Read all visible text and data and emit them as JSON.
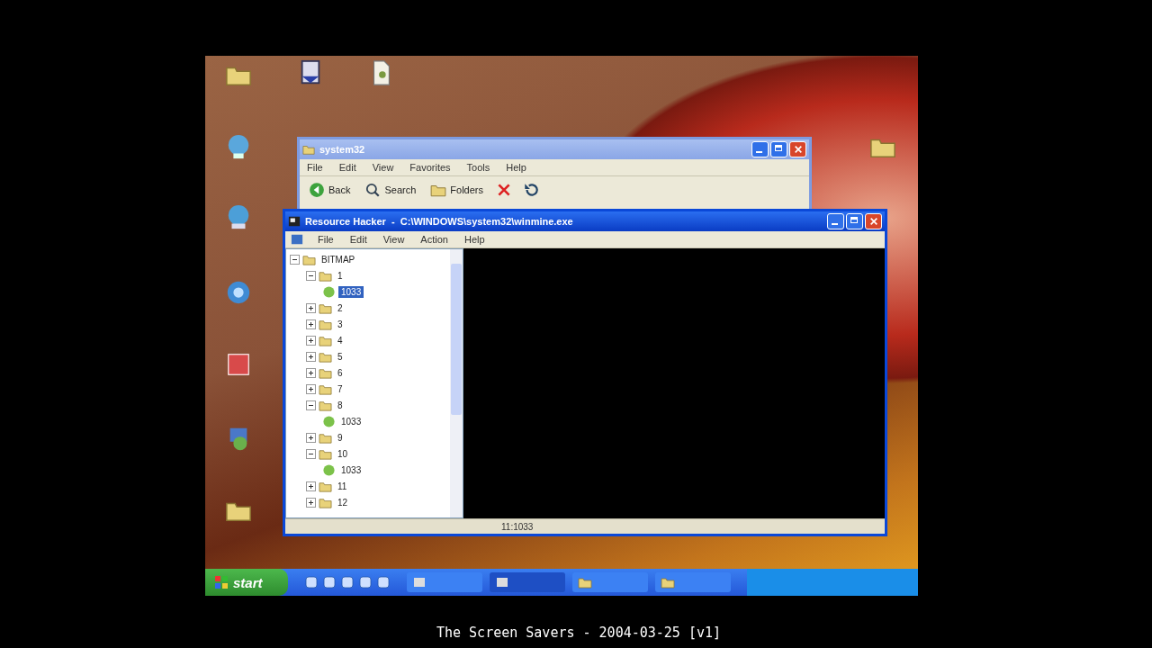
{
  "back_window": {
    "title": "system32",
    "menu": [
      "File",
      "Edit",
      "View",
      "Favorites",
      "Tools",
      "Help"
    ],
    "toolbar": [
      "Back",
      "Search",
      "Folders"
    ]
  },
  "main_window": {
    "title": "Resource Hacker  -  C:\\WINDOWS\\system32\\winmine.exe",
    "menu": [
      "File",
      "Edit",
      "View",
      "Action",
      "Help"
    ],
    "tree": [
      {
        "label": "BITMAP",
        "expanded": true,
        "children": [
          {
            "label": "1",
            "expanded": true,
            "children": [
              {
                "label": "1033",
                "selected": true
              }
            ]
          },
          {
            "label": "2",
            "expanded": false
          },
          {
            "label": "3",
            "expanded": false
          },
          {
            "label": "4",
            "expanded": false
          },
          {
            "label": "5",
            "expanded": false
          },
          {
            "label": "6",
            "expanded": false
          },
          {
            "label": "7",
            "expanded": false
          },
          {
            "label": "8",
            "expanded": true,
            "children": [
              {
                "label": "1033",
                "selected": false
              }
            ]
          },
          {
            "label": "9",
            "expanded": false
          },
          {
            "label": "10",
            "expanded": true,
            "children": [
              {
                "label": "1033",
                "selected": false
              }
            ]
          },
          {
            "label": "11",
            "expanded": false
          },
          {
            "label": "12",
            "expanded": false
          }
        ]
      }
    ],
    "status": "11:1033"
  },
  "taskbar": {
    "start": "start"
  },
  "caption": "The Screen Savers - 2004-03-25 [v1]"
}
